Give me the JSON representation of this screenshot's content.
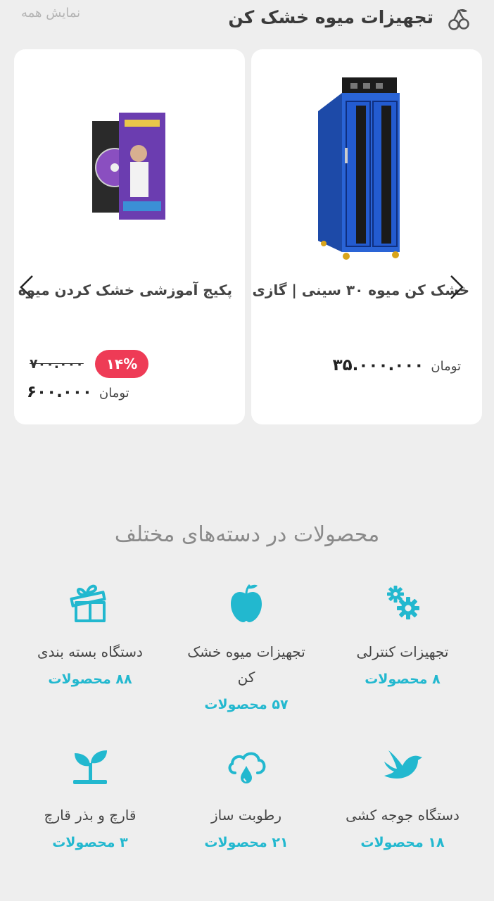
{
  "section": {
    "title": "تجهیزات میوه خشک کن",
    "view_all": "نمایش همه"
  },
  "products": [
    {
      "name": "خشک کن میوه ۳۰ سینی | گازی",
      "currency": "تومان",
      "price": "۳۵.۰۰۰.۰۰۰"
    },
    {
      "name": "پکیج آموزشی خشک کردن میوه",
      "discount": "۱۴%",
      "old_price": "۷۰۰.۰۰۰",
      "currency": "تومان",
      "price": "۶۰۰.۰۰۰"
    }
  ],
  "categories": {
    "title": "محصولات در دسته‌های مختلف",
    "items": [
      {
        "name": "تجهیزات کنترلی",
        "count": "۸ محصولات",
        "icon": "gears-icon"
      },
      {
        "name": "تجهیزات میوه خشک کن",
        "count": "۵۷ محصولات",
        "icon": "apple-icon"
      },
      {
        "name": "دستگاه بسته بندی",
        "count": "۸۸ محصولات",
        "icon": "gift-icon"
      },
      {
        "name": "دستگاه جوجه کشی",
        "count": "۱۸ محصولات",
        "icon": "bird-icon"
      },
      {
        "name": "رطوبت ساز",
        "count": "۲۱ محصولات",
        "icon": "cloud-drop-icon"
      },
      {
        "name": "قارچ و بذر قارچ",
        "count": "۳ محصولات",
        "icon": "sprout-icon"
      }
    ]
  },
  "colors": {
    "accent": "#22b8cf",
    "badge": "#ee3b56",
    "background": "#eeeeee",
    "product_blue": "#1f57c8"
  }
}
